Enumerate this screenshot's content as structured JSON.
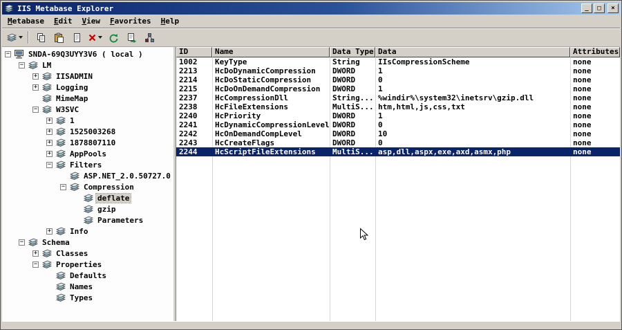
{
  "window": {
    "title": "IIS Metabase Explorer",
    "controls": {
      "minimize": "_",
      "maximize": "□",
      "close": "×"
    }
  },
  "menu": {
    "items": [
      "Metabase",
      "Edit",
      "View",
      "Favorites",
      "Help"
    ]
  },
  "toolbar": {
    "buttons": [
      {
        "name": "new-key-button",
        "icon": "keys",
        "dropdown": true
      },
      {
        "separator": true
      },
      {
        "name": "copy-button",
        "icon": "copy"
      },
      {
        "name": "paste-button",
        "icon": "paste"
      },
      {
        "name": "properties-button",
        "icon": "doc"
      },
      {
        "name": "delete-button",
        "icon": "delete",
        "dropdown": true
      },
      {
        "name": "refresh-button",
        "icon": "refresh"
      },
      {
        "name": "export-button",
        "icon": "export"
      },
      {
        "name": "connect-button",
        "icon": "connect"
      }
    ]
  },
  "tree": {
    "nodes": [
      {
        "label": "SNDA-69Q3UYY3V6 ( local )",
        "depth": 0,
        "expander": "minus",
        "icon": "computer",
        "selected": false
      },
      {
        "label": "LM",
        "depth": 1,
        "expander": "minus",
        "icon": "keys",
        "selected": false
      },
      {
        "label": "IISADMIN",
        "depth": 2,
        "expander": "plus",
        "icon": "keys",
        "selected": false
      },
      {
        "label": "Logging",
        "depth": 2,
        "expander": "plus",
        "icon": "keys",
        "selected": false
      },
      {
        "label": "MimeMap",
        "depth": 2,
        "expander": "none",
        "icon": "keys",
        "selected": false
      },
      {
        "label": "W3SVC",
        "depth": 2,
        "expander": "minus",
        "icon": "keys",
        "selected": false
      },
      {
        "label": "1",
        "depth": 3,
        "expander": "plus",
        "icon": "keys",
        "selected": false
      },
      {
        "label": "1525003268",
        "depth": 3,
        "expander": "plus",
        "icon": "keys",
        "selected": false
      },
      {
        "label": "1878807110",
        "depth": 3,
        "expander": "plus",
        "icon": "keys",
        "selected": false
      },
      {
        "label": "AppPools",
        "depth": 3,
        "expander": "plus",
        "icon": "keys",
        "selected": false
      },
      {
        "label": "Filters",
        "depth": 3,
        "expander": "minus",
        "icon": "keys",
        "selected": false
      },
      {
        "label": "ASP.NET_2.0.50727.0",
        "depth": 4,
        "expander": "none",
        "icon": "keys",
        "selected": false
      },
      {
        "label": "Compression",
        "depth": 4,
        "expander": "minus",
        "icon": "keys",
        "selected": false
      },
      {
        "label": "deflate",
        "depth": 5,
        "expander": "none",
        "icon": "keys",
        "selected": true
      },
      {
        "label": "gzip",
        "depth": 5,
        "expander": "none",
        "icon": "keys",
        "selected": false
      },
      {
        "label": "Parameters",
        "depth": 5,
        "expander": "none",
        "icon": "keys",
        "selected": false
      },
      {
        "label": "Info",
        "depth": 3,
        "expander": "plus",
        "icon": "keys",
        "selected": false
      },
      {
        "label": "Schema",
        "depth": 1,
        "expander": "minus",
        "icon": "keys",
        "selected": false
      },
      {
        "label": "Classes",
        "depth": 2,
        "expander": "plus",
        "icon": "keys",
        "selected": false
      },
      {
        "label": "Properties",
        "depth": 2,
        "expander": "minus",
        "icon": "keys",
        "selected": false
      },
      {
        "label": "Defaults",
        "depth": 3,
        "expander": "none",
        "icon": "keys",
        "selected": false
      },
      {
        "label": "Names",
        "depth": 3,
        "expander": "none",
        "icon": "keys",
        "selected": false
      },
      {
        "label": "Types",
        "depth": 3,
        "expander": "none",
        "icon": "keys",
        "selected": false
      }
    ]
  },
  "table": {
    "columns": [
      "ID",
      "Name",
      "Data Type",
      "Data",
      "Attributes"
    ],
    "rows": [
      [
        "1002",
        "KeyType",
        "String",
        "IIsCompressionScheme",
        "none"
      ],
      [
        "2213",
        "HcDoDynamicCompression",
        "DWORD",
        "1",
        "none"
      ],
      [
        "2214",
        "HcDoStaticCompression",
        "DWORD",
        "0",
        "none"
      ],
      [
        "2215",
        "HcDoOnDemandCompression",
        "DWORD",
        "1",
        "none"
      ],
      [
        "2237",
        "HcCompressionDll",
        "String...",
        "%windir%\\system32\\inetsrv\\gzip.dll",
        "none"
      ],
      [
        "2238",
        "HcFileExtensions",
        "MultiS...",
        "htm,html,js,css,txt",
        "none"
      ],
      [
        "2240",
        "HcPriority",
        "DWORD",
        "1",
        "none"
      ],
      [
        "2241",
        "HcDynamicCompressionLevel",
        "DWORD",
        "0",
        "none"
      ],
      [
        "2242",
        "HcOnDemandCompLevel",
        "DWORD",
        "10",
        "none"
      ],
      [
        "2243",
        "HcCreateFlags",
        "DWORD",
        "0",
        "none"
      ],
      [
        "2244",
        "HcScriptFileExtensions",
        "MultiS...",
        "asp,dll,aspx,exe,axd,asmx,php",
        "none"
      ]
    ],
    "selected_row_index": 10
  },
  "colors": {
    "titlebar_left": "#0a246a",
    "titlebar_right": "#a6caf0",
    "chrome": "#d4d0c8",
    "selection": "#0a246a",
    "selection_text": "#ffffff"
  }
}
